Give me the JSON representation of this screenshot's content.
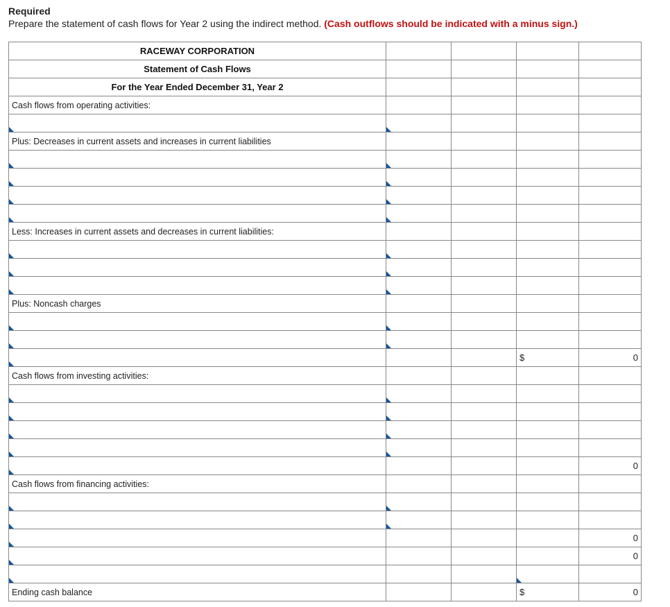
{
  "heading": "Required",
  "instructions": "Prepare the statement of cash flows for Year 2 using the indirect method. ",
  "hint": "(Cash outflows should be indicated with a minus sign.)",
  "header": {
    "company": "RACEWAY CORPORATION",
    "title": "Statement of Cash Flows",
    "period": "For the Year Ended December 31, Year 2"
  },
  "rows": {
    "op_activities": "Cash flows from operating activities:",
    "plus_decreases": "Plus: Decreases in current assets and increases in current liabilities",
    "less_increases": "Less: Increases in current assets and decreases in current liabilities:",
    "plus_noncash": "Plus: Noncash charges",
    "inv_activities": "Cash flows from investing activities:",
    "fin_activities": "Cash flows from financing activities:",
    "ending_balance": "Ending cash balance"
  },
  "currency": "$",
  "zero": "0"
}
